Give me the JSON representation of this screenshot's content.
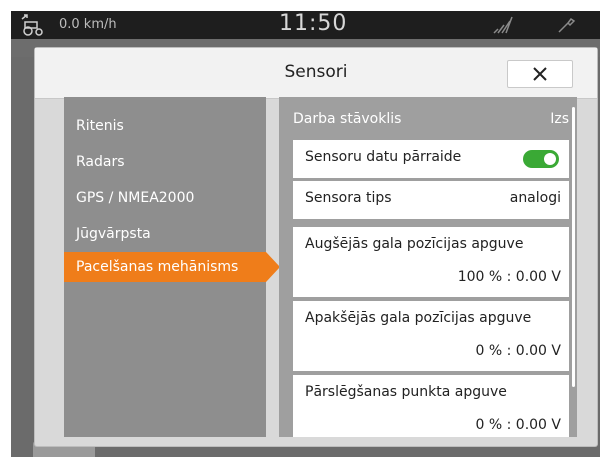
{
  "status_bar": {
    "speed": "0.0 km/h",
    "time": "11:50",
    "icons": [
      "tractor-icon",
      "signal-icon",
      "tool-icon"
    ]
  },
  "dialog": {
    "title": "Sensori",
    "close_icon": "×"
  },
  "nav": {
    "items": [
      {
        "label": "Ritenis",
        "active": false
      },
      {
        "label": "Radars",
        "active": false
      },
      {
        "label": "GPS / NMEA2000",
        "active": false
      },
      {
        "label": "Jūgvārpsta",
        "active": false
      },
      {
        "label": "Pacelšanas mehānisms",
        "active": true
      }
    ]
  },
  "content": {
    "operating_state": {
      "label": "Darba stāvoklis",
      "value": "Izs"
    },
    "sensor_transfer": {
      "label": "Sensoru datu pārraide",
      "enabled": true
    },
    "sensor_type": {
      "label": "Sensora tips",
      "value": "analogi"
    },
    "upper_position": {
      "label": "Augšējās gala pozīcijas apguve",
      "value": "100 % : 0.00 V"
    },
    "lower_position": {
      "label": "Apakšējās gala pozīcijas apguve",
      "value": "0 % : 0.00 V"
    },
    "switch_point": {
      "label": "Pārslēgšanas punkta apguve",
      "value": "0 % : 0.00 V"
    }
  },
  "colors": {
    "accent": "#ef7d1a",
    "toggle_on": "#3aa935"
  }
}
